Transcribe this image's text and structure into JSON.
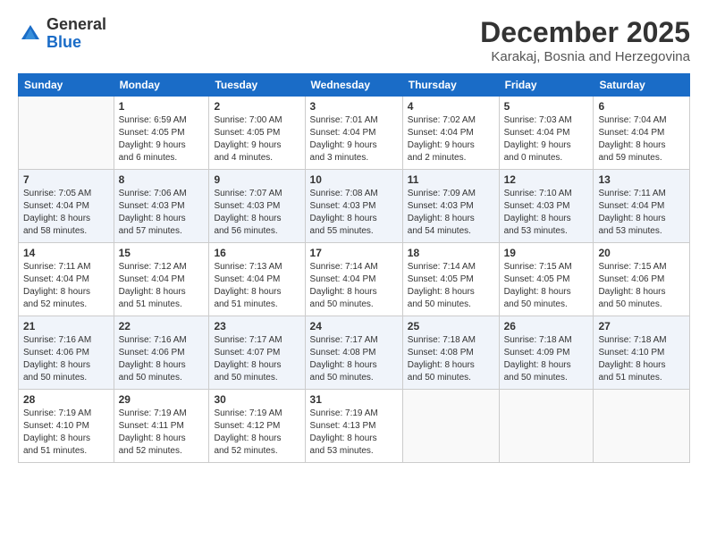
{
  "header": {
    "logo_general": "General",
    "logo_blue": "Blue",
    "month_title": "December 2025",
    "location": "Karakaj, Bosnia and Herzegovina"
  },
  "days_of_week": [
    "Sunday",
    "Monday",
    "Tuesday",
    "Wednesday",
    "Thursday",
    "Friday",
    "Saturday"
  ],
  "weeks": [
    [
      {
        "day": "",
        "info": ""
      },
      {
        "day": "1",
        "info": "Sunrise: 6:59 AM\nSunset: 4:05 PM\nDaylight: 9 hours\nand 6 minutes."
      },
      {
        "day": "2",
        "info": "Sunrise: 7:00 AM\nSunset: 4:05 PM\nDaylight: 9 hours\nand 4 minutes."
      },
      {
        "day": "3",
        "info": "Sunrise: 7:01 AM\nSunset: 4:04 PM\nDaylight: 9 hours\nand 3 minutes."
      },
      {
        "day": "4",
        "info": "Sunrise: 7:02 AM\nSunset: 4:04 PM\nDaylight: 9 hours\nand 2 minutes."
      },
      {
        "day": "5",
        "info": "Sunrise: 7:03 AM\nSunset: 4:04 PM\nDaylight: 9 hours\nand 0 minutes."
      },
      {
        "day": "6",
        "info": "Sunrise: 7:04 AM\nSunset: 4:04 PM\nDaylight: 8 hours\nand 59 minutes."
      }
    ],
    [
      {
        "day": "7",
        "info": "Sunrise: 7:05 AM\nSunset: 4:04 PM\nDaylight: 8 hours\nand 58 minutes."
      },
      {
        "day": "8",
        "info": "Sunrise: 7:06 AM\nSunset: 4:03 PM\nDaylight: 8 hours\nand 57 minutes."
      },
      {
        "day": "9",
        "info": "Sunrise: 7:07 AM\nSunset: 4:03 PM\nDaylight: 8 hours\nand 56 minutes."
      },
      {
        "day": "10",
        "info": "Sunrise: 7:08 AM\nSunset: 4:03 PM\nDaylight: 8 hours\nand 55 minutes."
      },
      {
        "day": "11",
        "info": "Sunrise: 7:09 AM\nSunset: 4:03 PM\nDaylight: 8 hours\nand 54 minutes."
      },
      {
        "day": "12",
        "info": "Sunrise: 7:10 AM\nSunset: 4:03 PM\nDaylight: 8 hours\nand 53 minutes."
      },
      {
        "day": "13",
        "info": "Sunrise: 7:11 AM\nSunset: 4:04 PM\nDaylight: 8 hours\nand 53 minutes."
      }
    ],
    [
      {
        "day": "14",
        "info": "Sunrise: 7:11 AM\nSunset: 4:04 PM\nDaylight: 8 hours\nand 52 minutes."
      },
      {
        "day": "15",
        "info": "Sunrise: 7:12 AM\nSunset: 4:04 PM\nDaylight: 8 hours\nand 51 minutes."
      },
      {
        "day": "16",
        "info": "Sunrise: 7:13 AM\nSunset: 4:04 PM\nDaylight: 8 hours\nand 51 minutes."
      },
      {
        "day": "17",
        "info": "Sunrise: 7:14 AM\nSunset: 4:04 PM\nDaylight: 8 hours\nand 50 minutes."
      },
      {
        "day": "18",
        "info": "Sunrise: 7:14 AM\nSunset: 4:05 PM\nDaylight: 8 hours\nand 50 minutes."
      },
      {
        "day": "19",
        "info": "Sunrise: 7:15 AM\nSunset: 4:05 PM\nDaylight: 8 hours\nand 50 minutes."
      },
      {
        "day": "20",
        "info": "Sunrise: 7:15 AM\nSunset: 4:06 PM\nDaylight: 8 hours\nand 50 minutes."
      }
    ],
    [
      {
        "day": "21",
        "info": "Sunrise: 7:16 AM\nSunset: 4:06 PM\nDaylight: 8 hours\nand 50 minutes."
      },
      {
        "day": "22",
        "info": "Sunrise: 7:16 AM\nSunset: 4:06 PM\nDaylight: 8 hours\nand 50 minutes."
      },
      {
        "day": "23",
        "info": "Sunrise: 7:17 AM\nSunset: 4:07 PM\nDaylight: 8 hours\nand 50 minutes."
      },
      {
        "day": "24",
        "info": "Sunrise: 7:17 AM\nSunset: 4:08 PM\nDaylight: 8 hours\nand 50 minutes."
      },
      {
        "day": "25",
        "info": "Sunrise: 7:18 AM\nSunset: 4:08 PM\nDaylight: 8 hours\nand 50 minutes."
      },
      {
        "day": "26",
        "info": "Sunrise: 7:18 AM\nSunset: 4:09 PM\nDaylight: 8 hours\nand 50 minutes."
      },
      {
        "day": "27",
        "info": "Sunrise: 7:18 AM\nSunset: 4:10 PM\nDaylight: 8 hours\nand 51 minutes."
      }
    ],
    [
      {
        "day": "28",
        "info": "Sunrise: 7:19 AM\nSunset: 4:10 PM\nDaylight: 8 hours\nand 51 minutes."
      },
      {
        "day": "29",
        "info": "Sunrise: 7:19 AM\nSunset: 4:11 PM\nDaylight: 8 hours\nand 52 minutes."
      },
      {
        "day": "30",
        "info": "Sunrise: 7:19 AM\nSunset: 4:12 PM\nDaylight: 8 hours\nand 52 minutes."
      },
      {
        "day": "31",
        "info": "Sunrise: 7:19 AM\nSunset: 4:13 PM\nDaylight: 8 hours\nand 53 minutes."
      },
      {
        "day": "",
        "info": ""
      },
      {
        "day": "",
        "info": ""
      },
      {
        "day": "",
        "info": ""
      }
    ]
  ]
}
